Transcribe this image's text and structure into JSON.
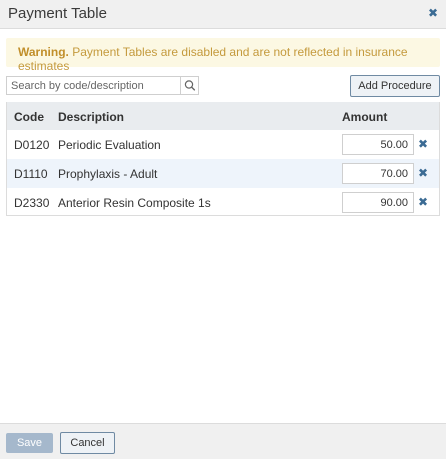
{
  "dialog": {
    "title": "Payment Table",
    "close_icon": "close-x-icon"
  },
  "warning": {
    "label": "Warning.",
    "message": " Payment Tables are disabled and are not reflected in insurance estimates"
  },
  "search": {
    "placeholder": "Search by code/description",
    "value": "",
    "icon": "search-icon"
  },
  "toolbar": {
    "add_label": "Add Procedure"
  },
  "table": {
    "headers": {
      "code": "Code",
      "description": "Description",
      "amount": "Amount"
    },
    "rows": [
      {
        "code": "D0120",
        "description": "Periodic Evaluation",
        "amount": "50.00"
      },
      {
        "code": "D1110",
        "description": "Prophylaxis - Adult",
        "amount": "70.00"
      },
      {
        "code": "D2330",
        "description": "Anterior Resin Composite 1s",
        "amount": "90.00"
      }
    ],
    "remove_icon": "remove-x-icon"
  },
  "footer": {
    "save_label": "Save",
    "cancel_label": "Cancel"
  },
  "colors": {
    "accent": "#3b6b94",
    "warning_bg": "#fcf8e3",
    "warning_text": "#c49a3d",
    "header_bg": "#e9ecef",
    "row_highlight": "#eef4fb",
    "save_disabled": "#a5b8cc"
  }
}
